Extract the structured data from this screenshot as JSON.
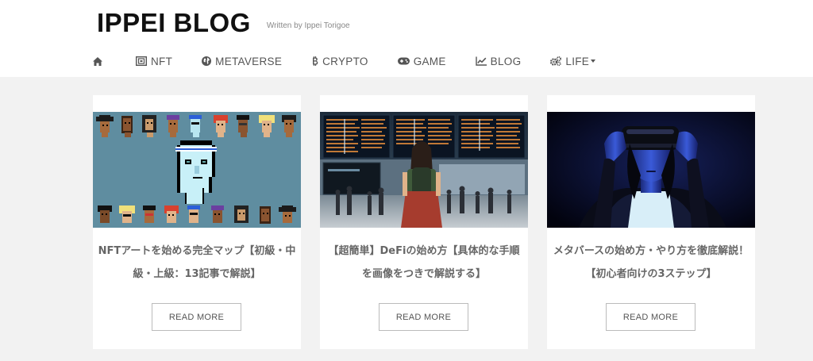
{
  "site": {
    "logo": "IPPEI BLOG",
    "tagline": "Written by Ippei Torigoe"
  },
  "nav": {
    "items": [
      {
        "label": "",
        "icon": "home-icon"
      },
      {
        "label": "NFT",
        "icon": "nft-frame-icon"
      },
      {
        "label": "METAVERSE",
        "icon": "globe-icon"
      },
      {
        "label": "CRYPTO",
        "icon": "bitcoin-icon"
      },
      {
        "label": "GAME",
        "icon": "gamepad-icon"
      },
      {
        "label": "BLOG",
        "icon": "line-chart-icon"
      },
      {
        "label": "LIFE",
        "icon": "cogs-icon",
        "dropdown": true
      }
    ]
  },
  "posts": [
    {
      "title": "NFTアートを始める完全マップ【初級・中級・上級：13記事で解説】",
      "thumbnail": "cryptopunks-pixel-art",
      "button": "READ MORE"
    },
    {
      "title": "【超簡単】DeFiの始め方【具体的な手順を画像をつきで解説する】",
      "thumbnail": "airport-departure-board",
      "button": "READ MORE"
    },
    {
      "title": "メタバースの始め方・やり方を徹底解説！【初心者向けの3ステップ】",
      "thumbnail": "vr-headset-person",
      "button": "READ MORE"
    }
  ],
  "colors": {
    "header_bg": "#ffffff",
    "page_bg": "#f2f2f2",
    "title_text": "#666666",
    "nav_text": "#555555"
  }
}
